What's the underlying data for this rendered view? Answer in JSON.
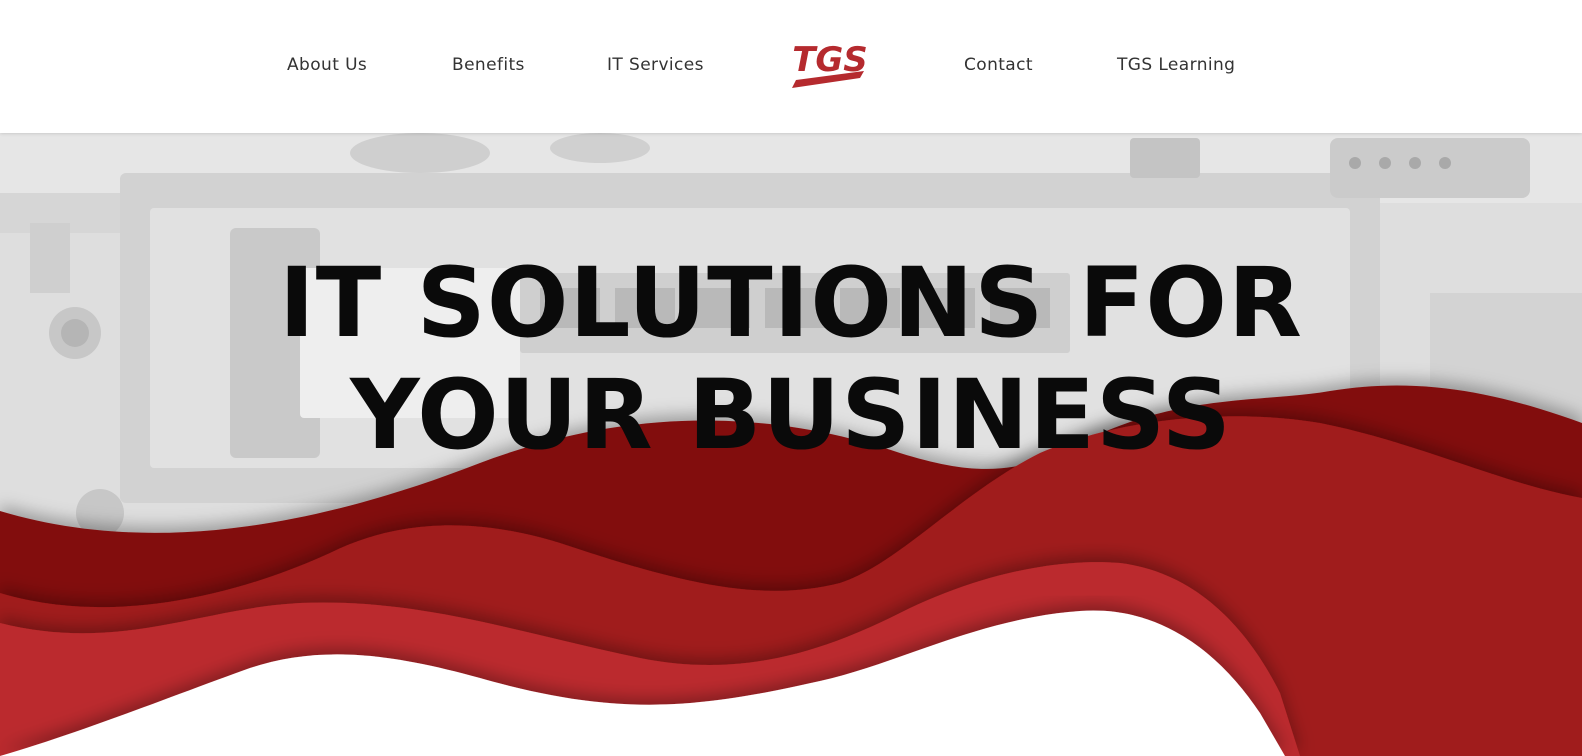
{
  "nav": {
    "items": [
      {
        "label": "About Us"
      },
      {
        "label": "Benefits"
      },
      {
        "label": "IT Services"
      },
      {
        "label": "Contact"
      },
      {
        "label": "TGS Learning"
      }
    ],
    "logo_text": "TGS"
  },
  "hero": {
    "title_line1": "IT SOLUTIONS FOR",
    "title_line2": "YOUR BUSINESS"
  },
  "colors": {
    "brand_red": "#b52a2e",
    "wave_dark": "#82100f",
    "wave_mid": "#a01b1b",
    "wave_light": "#bb2b2d"
  }
}
